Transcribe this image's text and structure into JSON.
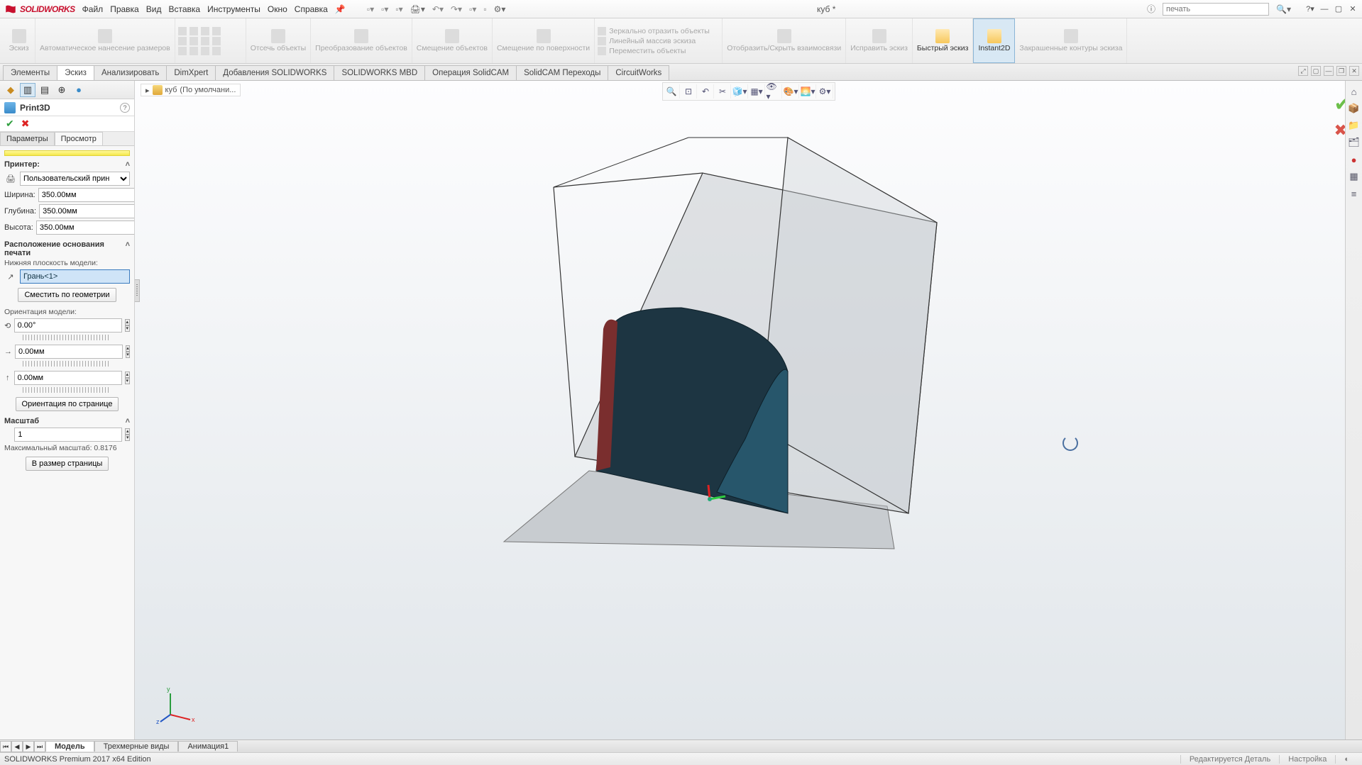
{
  "app": {
    "logo": "SOLIDWORKS"
  },
  "menu": {
    "file": "Файл",
    "edit": "Правка",
    "view": "Вид",
    "insert": "Вставка",
    "tools": "Инструменты",
    "window": "Окно",
    "help": "Справка"
  },
  "title_doc": "куб *",
  "search_placeholder": "печать",
  "ribbon": {
    "sketch": "Эскиз",
    "auto_dim": "Автоматическое нанесение размеров",
    "trim": "Отсечь объекты",
    "convert": "Преобразование объектов",
    "offset_obj": "Смещение объектов",
    "offset_surf": "Смещение по поверхности",
    "mirror": "Зеркально отразить объекты",
    "linear": "Линейный массив эскиза",
    "move": "Переместить объекты",
    "relations": "Отобразить/Скрыть взаимосвязи",
    "fix": "Исправить эскиз",
    "quick": "Быстрый эскиз",
    "instant2d": "Instant2D",
    "shaded": "Закрашенные контуры эскиза"
  },
  "tabs": {
    "features": "Элементы",
    "sketch": "Эскиз",
    "analyze": "Анализировать",
    "dimxpert": "DimXpert",
    "addins": "Добавления SOLIDWORKS",
    "mbd": "SOLIDWORKS MBD",
    "solidcam_op": "Операция  SolidCAM",
    "solidcam_tr": "SolidCAM Переходы",
    "circuit": "CircuitWorks"
  },
  "breadcrumb": {
    "part": "куб",
    "config": "(По умолчани..."
  },
  "panel": {
    "title": "Print3D",
    "tab_params": "Параметры",
    "tab_preview": "Просмотр",
    "printer_head": "Принтер:",
    "printer_value": "Пользовательский прин",
    "width_label": "Ширина:",
    "width_value": "350.00мм",
    "depth_label": "Глубина:",
    "depth_value": "350.00мм",
    "height_label": "Высота:",
    "height_value": "350.00мм",
    "location_head": "Расположение основания печати",
    "bottom_plane_label": "Нижняя плоскость модели:",
    "face_value": "Грань<1>",
    "offset_geom_btn": "Сместить по геометрии",
    "orient_head": "Ориентация модели:",
    "angle_value": "0.00°",
    "dx_value": "0.00мм",
    "dy_value": "0.00мм",
    "orient_page_btn": "Ориентация по странице",
    "scale_head": "Масштаб",
    "scale_value": "1",
    "max_scale": "Максимальный масштаб: 0.8176",
    "fit_page_btn": "В размер страницы"
  },
  "bottom_tabs": {
    "model": "Модель",
    "views3d": "Трехмерные виды",
    "anim": "Анимация1"
  },
  "status": {
    "edition": "SOLIDWORKS Premium 2017 x64 Edition",
    "editing": "Редактируется Деталь",
    "custom": "Настройка"
  }
}
